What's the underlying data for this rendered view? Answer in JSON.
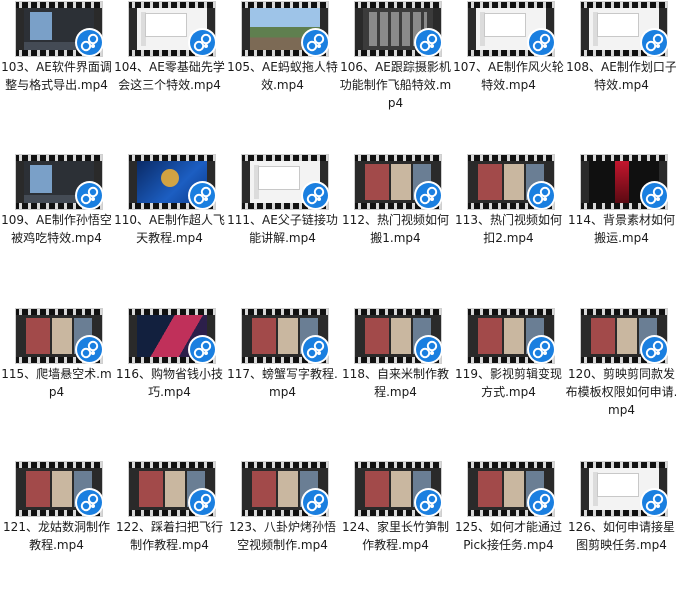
{
  "brand": {
    "play_badge_color": "#1a7fe0"
  },
  "items": [
    {
      "label": "103、AE软件界面调整与格式导出.mp4",
      "style": "f-dark"
    },
    {
      "label": "104、AE零基础先学会这三个特效.mp4",
      "style": "f-white"
    },
    {
      "label": "105、AE蚂蚁拖人特效.mp4",
      "style": "f-land"
    },
    {
      "label": "106、AE跟踪摄影机功能制作飞船特效.mp4",
      "style": "f-grid"
    },
    {
      "label": "107、AE制作风火轮特效.mp4",
      "style": "f-white"
    },
    {
      "label": "108、AE制作划口子特效.mp4",
      "style": "f-white"
    },
    {
      "label": "109、AE制作孙悟空被鸡吃特效.mp4",
      "style": "f-dark"
    },
    {
      "label": "110、AE制作超人飞天教程.mp4",
      "style": "f-desk"
    },
    {
      "label": "111、AE父子链接功能讲解.mp4",
      "style": "f-white"
    },
    {
      "label": "112、热门视频如何搬1.mp4",
      "style": "f-multi"
    },
    {
      "label": "113、热门视频如何扣2.mp4",
      "style": "f-multi"
    },
    {
      "label": "114、背景素材如何搬运.mp4",
      "style": "f-red"
    },
    {
      "label": "115、爬墙悬空术.mp4",
      "style": "f-multi"
    },
    {
      "label": "116、购物省钱小技巧.mp4",
      "style": "f-pink"
    },
    {
      "label": "117、螃蟹写字教程.mp4",
      "style": "f-multi"
    },
    {
      "label": "118、自来米制作教程.mp4",
      "style": "f-multi"
    },
    {
      "label": "119、影视剪辑变现方式.mp4",
      "style": "f-multi"
    },
    {
      "label": "120、剪映剪同款发布模板权限如何申请.mp4",
      "style": "f-multi"
    },
    {
      "label": "121、龙姑数洞制作教程.mp4",
      "style": "f-multi"
    },
    {
      "label": "122、踩着扫把飞行制作教程.mp4",
      "style": "f-multi"
    },
    {
      "label": "123、八卦炉烤孙悟空视频制作.mp4",
      "style": "f-multi"
    },
    {
      "label": "124、家里长竹笋制作教程.mp4",
      "style": "f-multi"
    },
    {
      "label": "125、如何才能通过Pick接任务.mp4",
      "style": "f-multi"
    },
    {
      "label": "126、如何申请接星图剪映任务.mp4",
      "style": "f-white"
    }
  ]
}
